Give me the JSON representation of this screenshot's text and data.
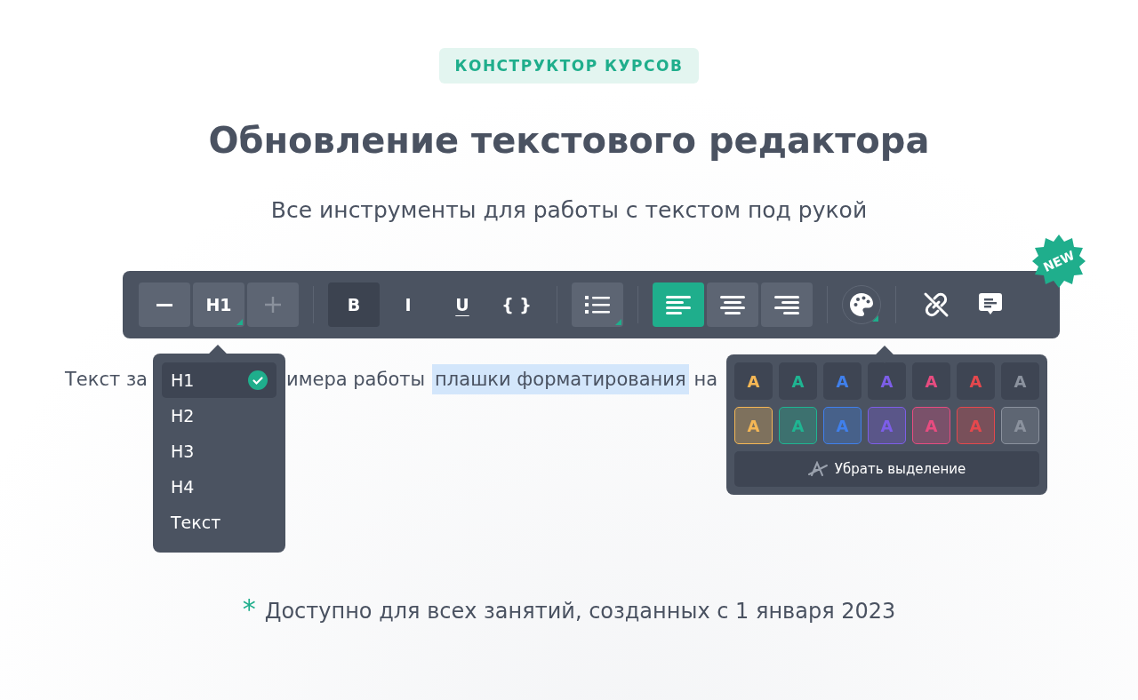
{
  "badge": "КОНСТРУКТОР КУРСОВ",
  "title": "Обновление текстового редактора",
  "subtitle": "Все инструменты для работы с текстом под рукой",
  "toolbar": {
    "new_badge": "NEW",
    "groups": [
      {
        "buttons": [
          {
            "kind": "minus",
            "selected": false,
            "disabled": false,
            "has_menu": false
          },
          {
            "kind": "text",
            "label": "H1",
            "selected": false,
            "disabled": false,
            "has_menu": true
          },
          {
            "kind": "plus",
            "selected": false,
            "disabled": true,
            "has_menu": false
          }
        ]
      },
      {
        "buttons": [
          {
            "kind": "text",
            "label": "B",
            "selected": true,
            "has_menu": false
          },
          {
            "kind": "text",
            "label": "I",
            "selected": false,
            "has_menu": false
          },
          {
            "kind": "underline",
            "label": "U",
            "selected": false,
            "has_menu": false
          },
          {
            "kind": "text",
            "label": "{ }",
            "selected": false,
            "has_menu": false
          }
        ]
      },
      {
        "buttons": [
          {
            "kind": "list",
            "selected": false,
            "has_menu": true
          }
        ]
      },
      {
        "buttons": [
          {
            "kind": "align-left",
            "selected": true,
            "has_menu": false
          },
          {
            "kind": "align-center",
            "selected": false,
            "has_menu": false
          },
          {
            "kind": "align-right",
            "selected": false,
            "has_menu": false
          }
        ]
      },
      {
        "buttons": [
          {
            "kind": "palette",
            "has_menu": true
          }
        ]
      },
      {
        "buttons": [
          {
            "kind": "unlink",
            "selected": false,
            "has_menu": false
          },
          {
            "kind": "comment",
            "selected": false,
            "has_menu": false
          }
        ]
      }
    ]
  },
  "sample_text": [
    {
      "text": "Текст за",
      "highlighted": false
    },
    {
      "text": "имера работы",
      "highlighted": false
    },
    {
      "text": "плашки форматирования",
      "highlighted": true
    },
    {
      "text": "на",
      "highlighted": false
    }
  ],
  "heading_menu": {
    "items": [
      {
        "label": "H1",
        "selected": true
      },
      {
        "label": "H2",
        "selected": false
      },
      {
        "label": "H3",
        "selected": false
      },
      {
        "label": "H4",
        "selected": false
      },
      {
        "label": "Текст",
        "selected": false
      }
    ]
  },
  "color_menu": {
    "rows": [
      {
        "kind": "text",
        "swatches": [
          {
            "label": "A",
            "color": "#f5b755"
          },
          {
            "label": "A",
            "color": "#1fb592"
          },
          {
            "label": "A",
            "color": "#4080ec"
          },
          {
            "label": "A",
            "color": "#7d5ee8"
          },
          {
            "label": "A",
            "color": "#e74c80"
          },
          {
            "label": "A",
            "color": "#e5484d"
          },
          {
            "label": "A",
            "color": "#8b929e"
          }
        ]
      },
      {
        "kind": "background",
        "swatches": [
          {
            "label": "A",
            "color": "#f5b755"
          },
          {
            "label": "A",
            "color": "#1fb592"
          },
          {
            "label": "A",
            "color": "#4080ec"
          },
          {
            "label": "A",
            "color": "#7d5ee8"
          },
          {
            "label": "A",
            "color": "#e74c80"
          },
          {
            "label": "A",
            "color": "#e5484d"
          },
          {
            "label": "A",
            "color": "#8b929e"
          }
        ]
      }
    ],
    "clear_button": "Убрать выделение"
  },
  "footnote": {
    "mark": "*",
    "text": "Доступно для всех занятий, созданных с 1 января 2023"
  }
}
